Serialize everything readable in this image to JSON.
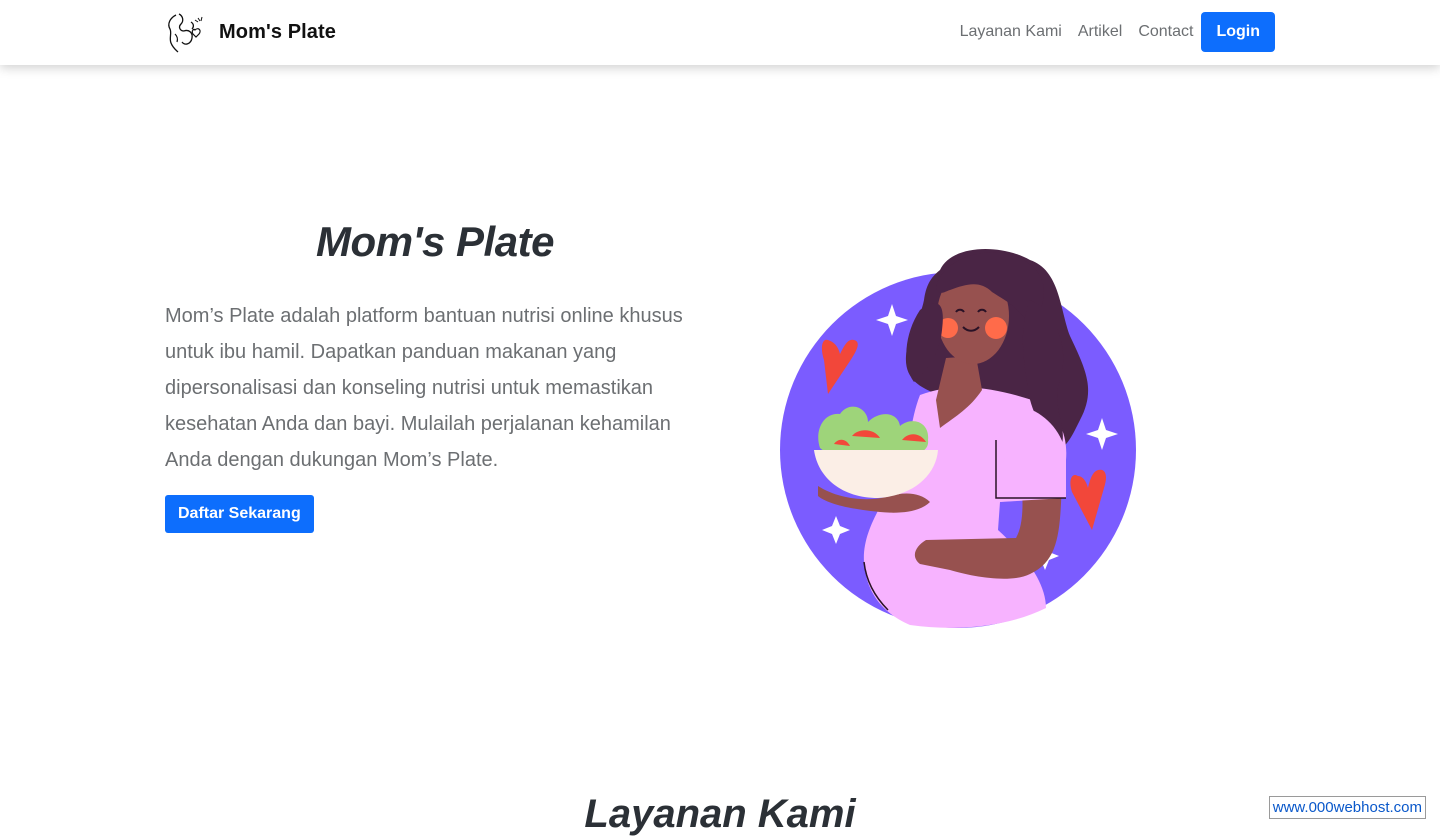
{
  "navbar": {
    "brand_name": "Mom's Plate",
    "links": [
      {
        "label": "Layanan Kami"
      },
      {
        "label": "Artikel"
      },
      {
        "label": "Contact"
      }
    ],
    "login_label": "Login"
  },
  "hero": {
    "title": "Mom's Plate",
    "description": "Mom’s Plate adalah platform bantuan nutrisi online khusus untuk ibu hamil. Dapatkan panduan makanan yang dipersonalisasi dan konseling nutrisi untuk memastikan kesehatan Anda dan bayi. Mulailah perjalanan kehamilan Anda dengan dukungan Mom’s Plate.",
    "cta_label": "Daftar Sekarang",
    "illustration_icon": "pregnant-woman-holding-salad-illustration"
  },
  "services": {
    "title": "Layanan Kami"
  },
  "hosting_badge": {
    "label": "www.000webhost.com"
  },
  "colors": {
    "primary": "#0d6efd",
    "heading": "#2b3036",
    "body_text": "#6c6f72",
    "illustration_circle": "#7b5cff",
    "dress": "#f7b3ff",
    "hair": "#4a2545",
    "skin": "#97514f",
    "heart": "#f2473a"
  }
}
